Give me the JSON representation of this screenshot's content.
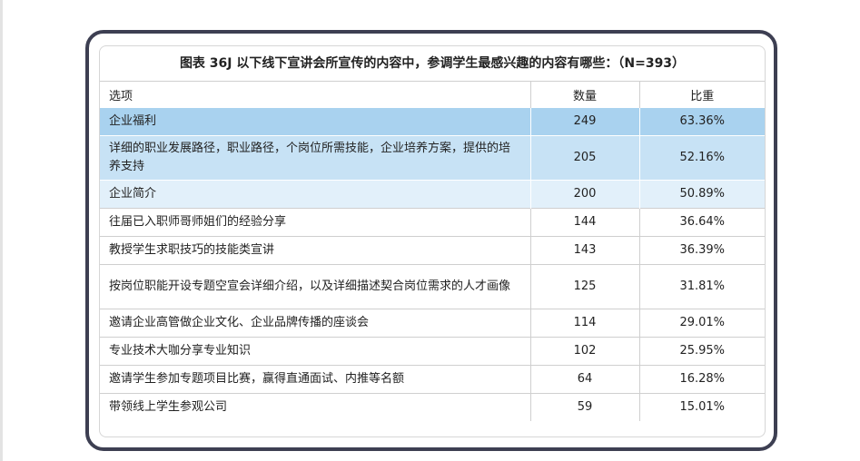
{
  "title": "图表 36J 以下线下宣讲会所宣传的内容中，参调学生最感兴趣的内容有哪些：（N=393）",
  "headers": {
    "option": "选项",
    "count": "数量",
    "ratio": "比重"
  },
  "rows": [
    {
      "option": "企业福利",
      "count": "249",
      "ratio": "63.36%"
    },
    {
      "option": "详细的职业发展路径，职业路径，个岗位所需技能，企业培养方案，提供的培养支持",
      "count": "205",
      "ratio": "52.16%"
    },
    {
      "option": "企业简介",
      "count": "200",
      "ratio": "50.89%"
    },
    {
      "option": "往届已入职师哥师姐们的经验分享",
      "count": "144",
      "ratio": "36.64%"
    },
    {
      "option": "教授学生求职技巧的技能类宣讲",
      "count": "143",
      "ratio": "36.39%"
    },
    {
      "option": "按岗位职能开设专题空宣会详细介绍，以及详细描述契合岗位需求的人才画像",
      "count": "125",
      "ratio": "31.81%"
    },
    {
      "option": "邀请企业高管做企业文化、企业品牌传播的座谈会",
      "count": "114",
      "ratio": "29.01%"
    },
    {
      "option": "专业技术大咖分享专业知识",
      "count": "102",
      "ratio": "25.95%"
    },
    {
      "option": "邀请学生参加专题项目比赛，赢得直通面试、内推等名额",
      "count": "64",
      "ratio": "16.28%"
    },
    {
      "option": "带领线上学生参观公司",
      "count": "59",
      "ratio": "15.01%"
    }
  ],
  "colors": {
    "frame": "#3d3f52",
    "highlight_1": "#a9d2ef",
    "highlight_2": "#c7e2f5",
    "highlight_3": "#e2f0fa"
  }
}
